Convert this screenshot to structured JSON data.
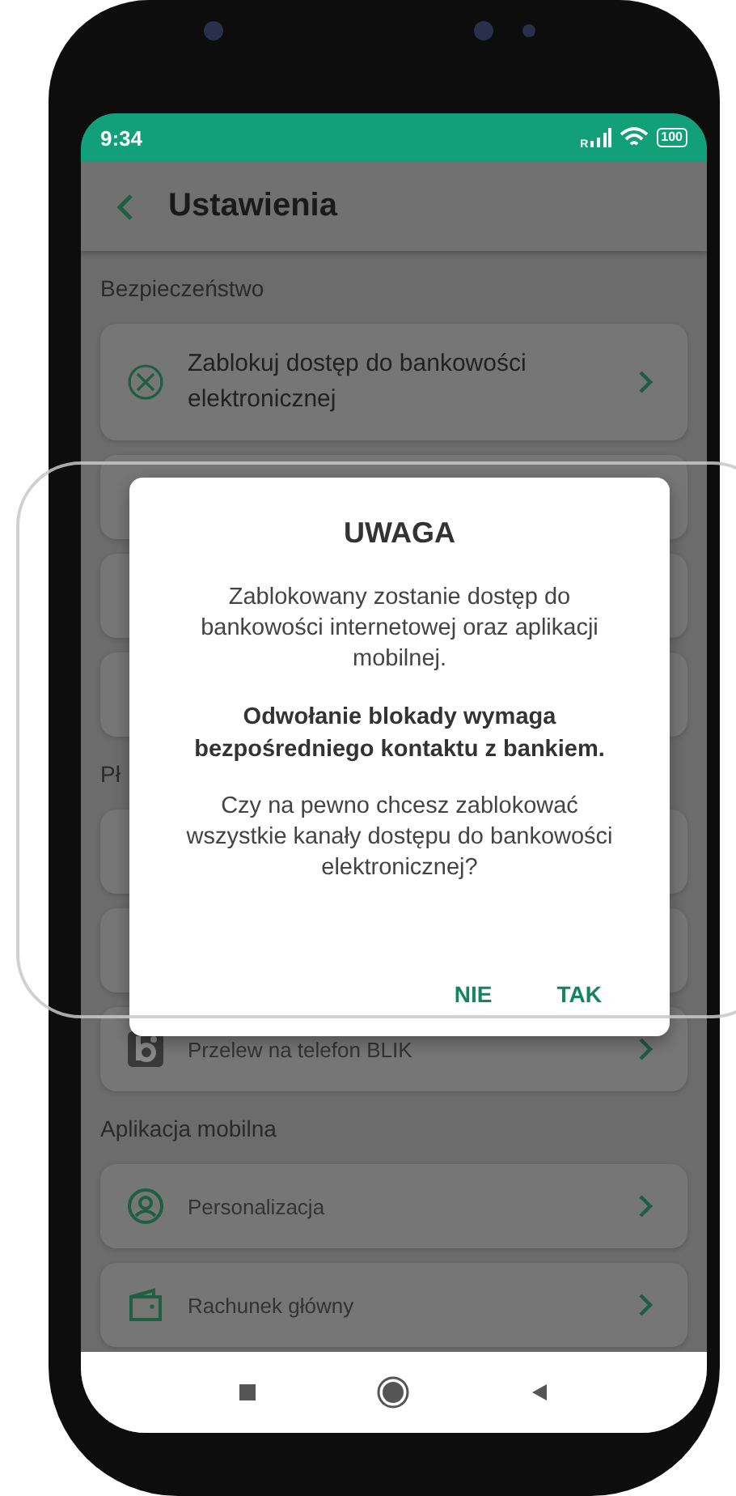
{
  "status_bar": {
    "time": "9:34",
    "network": "R",
    "battery": "100"
  },
  "header": {
    "title": "Ustawienia"
  },
  "sections": [
    {
      "label": "Bezpieczeństwo",
      "items": [
        {
          "kind": "block",
          "label": "Zablokuj dostęp do bankowości elektronicznej"
        },
        {
          "kind": "hidden"
        },
        {
          "kind": "hidden"
        },
        {
          "kind": "hidden"
        }
      ]
    },
    {
      "label": "Pł",
      "items": [
        {
          "kind": "hidden"
        },
        {
          "kind": "hidden"
        },
        {
          "kind": "blik",
          "label": "Przelew na telefon BLIK"
        }
      ]
    },
    {
      "label": "Aplikacja mobilna",
      "items": [
        {
          "kind": "person",
          "label": "Personalizacja"
        },
        {
          "kind": "wallet",
          "label": "Rachunek główny"
        }
      ]
    }
  ],
  "dialog": {
    "title": "UWAGA",
    "paragraphs": [
      {
        "text": "Zablokowany zostanie dostęp do bankowości internetowej oraz aplikacji mobilnej.",
        "bold": false
      },
      {
        "text": "Odwołanie blokady wymaga bezpośredniego kontaktu z bankiem.",
        "bold": true
      },
      {
        "text": "Czy na pewno chcesz zablokować wszystkie kanały dostępu do bankowości elektronicznej?",
        "bold": false
      }
    ],
    "buttons": [
      "NIE",
      "TAK"
    ]
  }
}
